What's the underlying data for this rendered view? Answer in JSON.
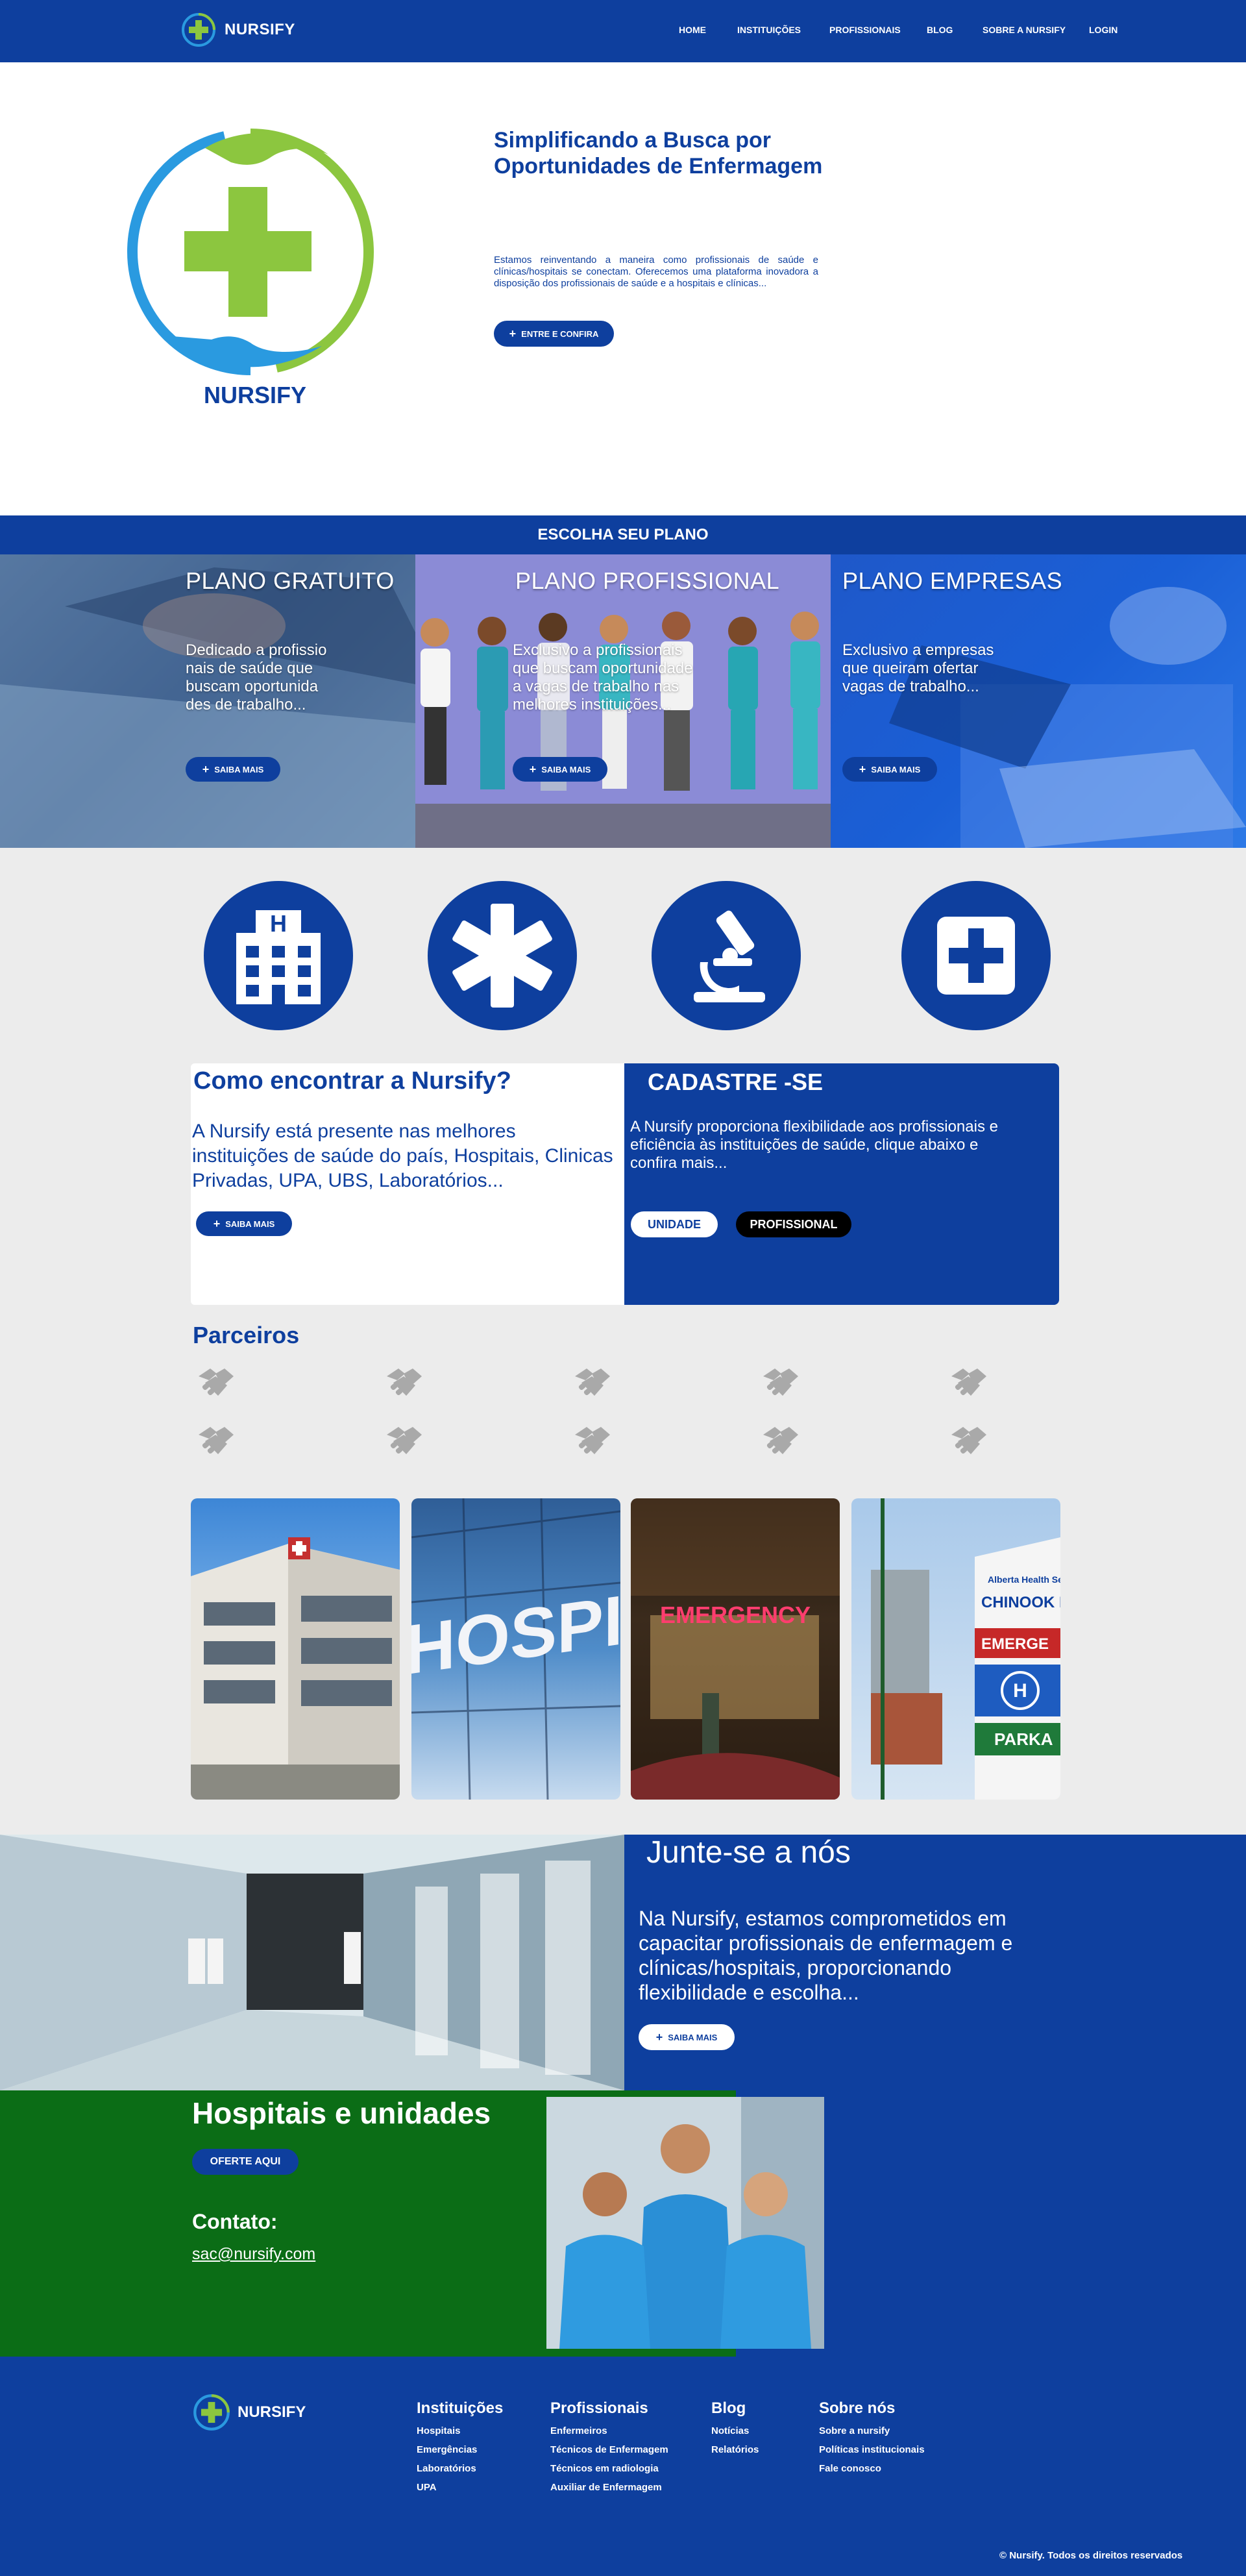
{
  "brand": {
    "name": "NURSIFY",
    "accent": "#0e3f9e",
    "green": "#8cc63f"
  },
  "nav": {
    "items": [
      "HOME",
      "INSTITUIÇÕES",
      "PROFISSIONAIS",
      "BLOG",
      "SOBRE A NURSIFY",
      "LOGIN"
    ]
  },
  "hero": {
    "title": "Simplificando a Busca por Oportunidades de Enfermagem",
    "description": "Estamos reinventando a maneira como profissionais de saúde e clínicas/hospitais se conectam. Oferecemos uma plataforma inovadora a disposição dos profissionais de saúde e a hospitais e clínicas...",
    "button": "ENTRE E CONFIRA",
    "logo_text": "NURSIFY"
  },
  "plans": {
    "heading": "ESCOLHA SEU PLANO",
    "items": [
      {
        "title": "PLANO GRATUITO",
        "text": "Dedicado a profissio nais de saúde que buscam oportunida des de trabalho...",
        "button": "SAIBA MAIS"
      },
      {
        "title": "PLANO PROFISSIONAL",
        "text": "Exclusivo a profissionais que buscam oportunidade a vagas de trabalho nas melhores instituições...",
        "button": "SAIBA MAIS"
      },
      {
        "title": "PLANO EMPRESAS",
        "text": "Exclusivo a empresas que queiram ofertar vagas de trabalho...",
        "button": "SAIBA MAIS"
      }
    ]
  },
  "icons": [
    "hospital-building-icon",
    "medical-star-icon",
    "microscope-icon",
    "medical-cross-icon"
  ],
  "find": {
    "title": "Como encontrar a Nursify?",
    "description": "A Nursify está presente nas melhores instituições de saúde do país, Hospitais, Clinicas Privadas, UPA, UBS, Laboratórios...",
    "button": "SAIBA MAIS"
  },
  "register": {
    "title": "CADASTRE -SE",
    "description": "A Nursify proporciona flexibilidade aos profissionais e eficiência às instituições de saúde, clique abaixo e confira mais...",
    "unit_button": "UNIDADE",
    "professional_button": "PROFISSIONAL"
  },
  "partners": {
    "title": "Parceiros",
    "logo_icon": "handshake-icon",
    "count": 10
  },
  "join": {
    "title": "Junte-se a nós",
    "description": "Na Nursify, estamos comprometidos em capacitar profissionais de enfermagem e clínicas/hospitais, proporcionando  flexibilidade e escolha...",
    "button": "SAIBA MAIS"
  },
  "hospitals": {
    "title": "Hospitais e unidades",
    "button": "OFERTE AQUI",
    "contact_label": "Contato:",
    "contact_email": "sac@nursify.com"
  },
  "footer": {
    "brand": "NURSIFY",
    "columns": [
      {
        "title": "Instituições",
        "links": [
          "Hospitais",
          "Emergências",
          "Laboratórios",
          "UPA"
        ]
      },
      {
        "title": "Profissionais",
        "links": [
          "Enfermeiros",
          "Técnicos de Enfermagem",
          "Técnicos em radiologia",
          "Auxiliar de Enfermagem"
        ]
      },
      {
        "title": "Blog",
        "links": [
          "Notícias",
          "Relatórios"
        ]
      },
      {
        "title": "Sobre nós",
        "links": [
          "Sobre a nursify",
          "Políticas institucionais",
          "Fale conosco"
        ]
      }
    ],
    "copyright": "© Nursify. Todos os direitos reservados"
  },
  "photo_cards": [
    "Hospital building exterior",
    "HOSPIT",
    "EMERGENCY",
    "CHINOOK REGIONAL HOSPITAL"
  ],
  "photo_sign_texts": {
    "hospit": "HOSPIT",
    "emergency": "EMERGENCY",
    "chinook_top": "Alberta Health Services",
    "chinook_name": "CHINOOK RE HOSPITAL",
    "emerge": "EMERGE",
    "parka": "PARKA",
    "h": "H"
  }
}
